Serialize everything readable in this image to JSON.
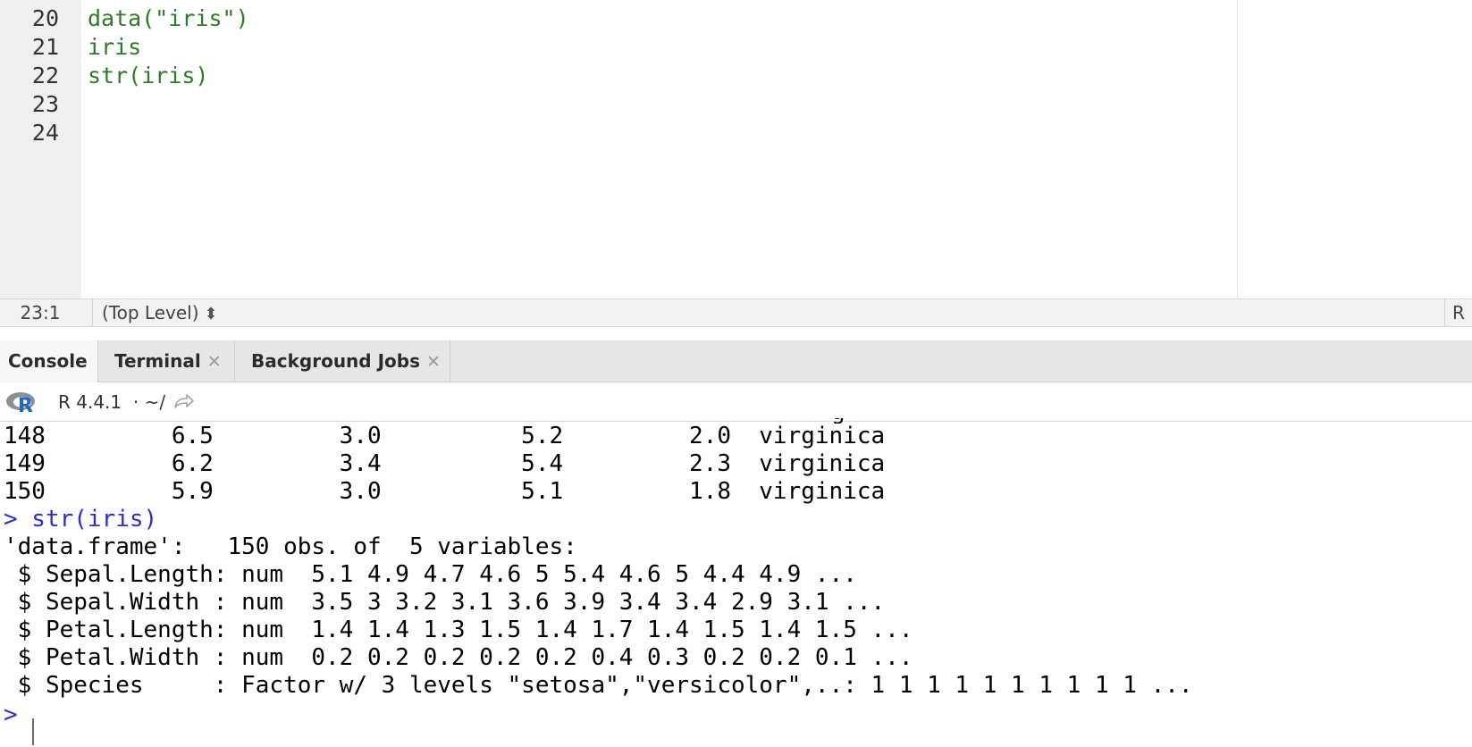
{
  "editor": {
    "line_numbers": [
      "20",
      "21",
      "22",
      "23",
      "24"
    ],
    "code_lines": [
      "data(\"iris\")",
      "iris",
      "str(iris)",
      "",
      ""
    ]
  },
  "statusbar": {
    "cursor_position": "23:1",
    "scope": "(Top Level)",
    "file_type": "R"
  },
  "tabs": [
    {
      "label": "Console",
      "active": true,
      "closable": false
    },
    {
      "label": "Terminal",
      "active": false,
      "closable": true
    },
    {
      "label": "Background Jobs",
      "active": false,
      "closable": true
    }
  ],
  "console_header": {
    "r_version": "R 4.4.1",
    "working_dir": "~/",
    "icon": "r-logo-icon",
    "nav_icon": "go-to-directory-icon"
  },
  "console": {
    "lines": [
      {
        "type": "output",
        "text": "148         6.5         3.0          5.2         2.0  virginica"
      },
      {
        "type": "output",
        "text": "149         6.2         3.4          5.4         2.3  virginica"
      },
      {
        "type": "output",
        "text": "150         5.9         3.0          5.1         1.8  virginica"
      },
      {
        "type": "command",
        "text": "> str(iris)"
      },
      {
        "type": "output",
        "text": "'data.frame':   150 obs. of  5 variables:"
      },
      {
        "type": "output",
        "text": " $ Sepal.Length: num  5.1 4.9 4.7 4.6 5 5.4 4.6 5 4.4 4.9 ..."
      },
      {
        "type": "output",
        "text": " $ Sepal.Width : num  3.5 3 3.2 3.1 3.6 3.9 3.4 3.4 2.9 3.1 ..."
      },
      {
        "type": "output",
        "text": " $ Petal.Length: num  1.4 1.4 1.3 1.5 1.4 1.7 1.4 1.5 1.4 1.5 ..."
      },
      {
        "type": "output",
        "text": " $ Petal.Width : num  0.2 0.2 0.2 0.2 0.2 0.4 0.3 0.2 0.2 0.1 ..."
      },
      {
        "type": "output",
        "text": " $ Species     : Factor w/ 3 levels \"setosa\",\"versicolor\",..: 1 1 1 1 1 1 1 1 1 1 ..."
      }
    ],
    "prompt": ">"
  },
  "colors": {
    "code_green": "#2e7a2b",
    "command_blue": "#2d2dcf",
    "gutter_bg": "#f0f0f0",
    "tabbar_bg": "#e6e6e6"
  }
}
